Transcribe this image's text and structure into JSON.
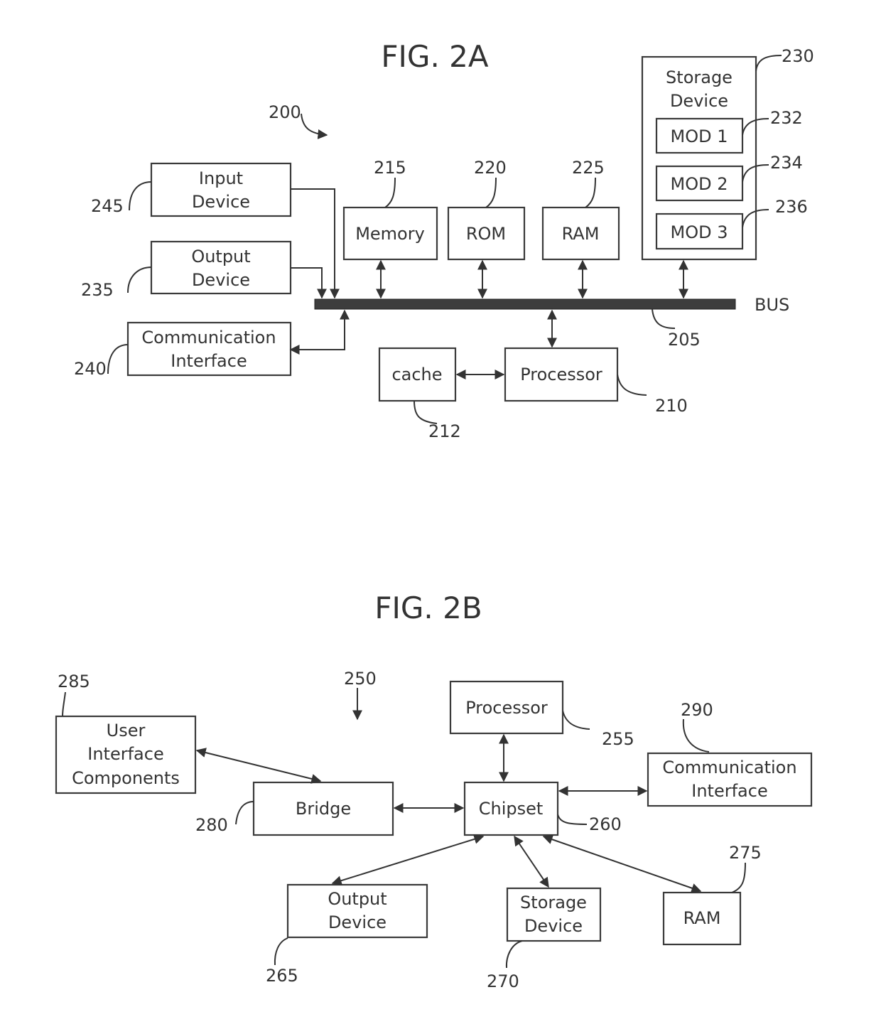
{
  "fig2a": {
    "title": "FIG. 2A",
    "system_ref": "200",
    "bus": {
      "label": "BUS",
      "ref": "205"
    },
    "blocks": {
      "input_device": {
        "line1": "Input",
        "line2": "Device",
        "ref": "245"
      },
      "output_device": {
        "line1": "Output",
        "line2": "Device",
        "ref": "235"
      },
      "communication_interface": {
        "line1": "Communication",
        "line2": "Interface",
        "ref": "240"
      },
      "memory": {
        "label": "Memory",
        "ref": "215"
      },
      "rom": {
        "label": "ROM",
        "ref": "220"
      },
      "ram": {
        "label": "RAM",
        "ref": "225"
      },
      "storage_device": {
        "line1": "Storage",
        "line2": "Device",
        "ref": "230"
      },
      "mod1": {
        "label": "MOD 1",
        "ref": "232"
      },
      "mod2": {
        "label": "MOD 2",
        "ref": "234"
      },
      "mod3": {
        "label": "MOD 3",
        "ref": "236"
      },
      "cache": {
        "label": "cache",
        "ref": "212"
      },
      "processor": {
        "label": "Processor",
        "ref": "210"
      }
    }
  },
  "fig2b": {
    "title": "FIG. 2B",
    "system_ref": "250",
    "blocks": {
      "user_interface": {
        "line1": "User",
        "line2": "Interface",
        "line3": "Components",
        "ref": "285"
      },
      "bridge": {
        "label": "Bridge",
        "ref": "280"
      },
      "processor": {
        "label": "Processor",
        "ref": "255"
      },
      "chipset": {
        "label": "Chipset",
        "ref": "260"
      },
      "communication_interface": {
        "line1": "Communication",
        "line2": "Interface",
        "ref": "290"
      },
      "output_device": {
        "line1": "Output",
        "line2": "Device",
        "ref": "265"
      },
      "storage_device": {
        "line1": "Storage",
        "line2": "Device",
        "ref": "270"
      },
      "ram": {
        "label": "RAM",
        "ref": "275"
      }
    }
  }
}
